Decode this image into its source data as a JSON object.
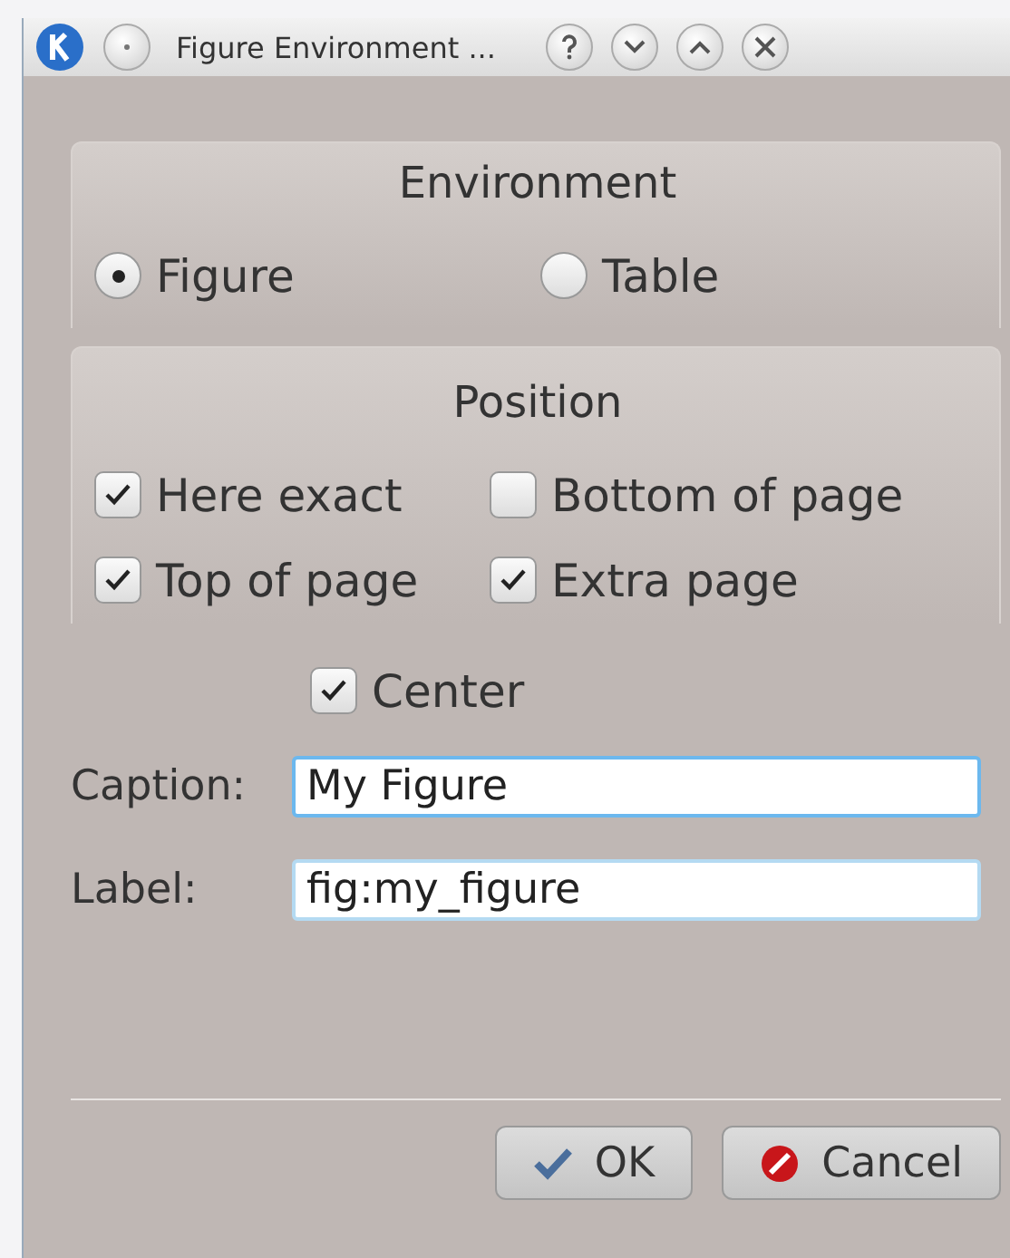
{
  "window": {
    "title": "Figure Environment ..."
  },
  "environment": {
    "title": "Environment",
    "options": [
      {
        "label": "Figure",
        "selected": true
      },
      {
        "label": "Table",
        "selected": false
      }
    ]
  },
  "position": {
    "title": "Position",
    "options": [
      {
        "label": "Here exact",
        "checked": true
      },
      {
        "label": "Bottom of page",
        "checked": false
      },
      {
        "label": "Top of page",
        "checked": true
      },
      {
        "label": "Extra page",
        "checked": true
      }
    ]
  },
  "center": {
    "label": "Center",
    "checked": true
  },
  "fields": [
    {
      "label": "Caption:",
      "value": "My Figure",
      "focused": true
    },
    {
      "label": "Label:",
      "value": "fig:my_figure",
      "focused": false
    }
  ],
  "buttons": [
    {
      "label": "OK",
      "kind": "ok"
    },
    {
      "label": "Cancel",
      "kind": "cancel"
    }
  ]
}
